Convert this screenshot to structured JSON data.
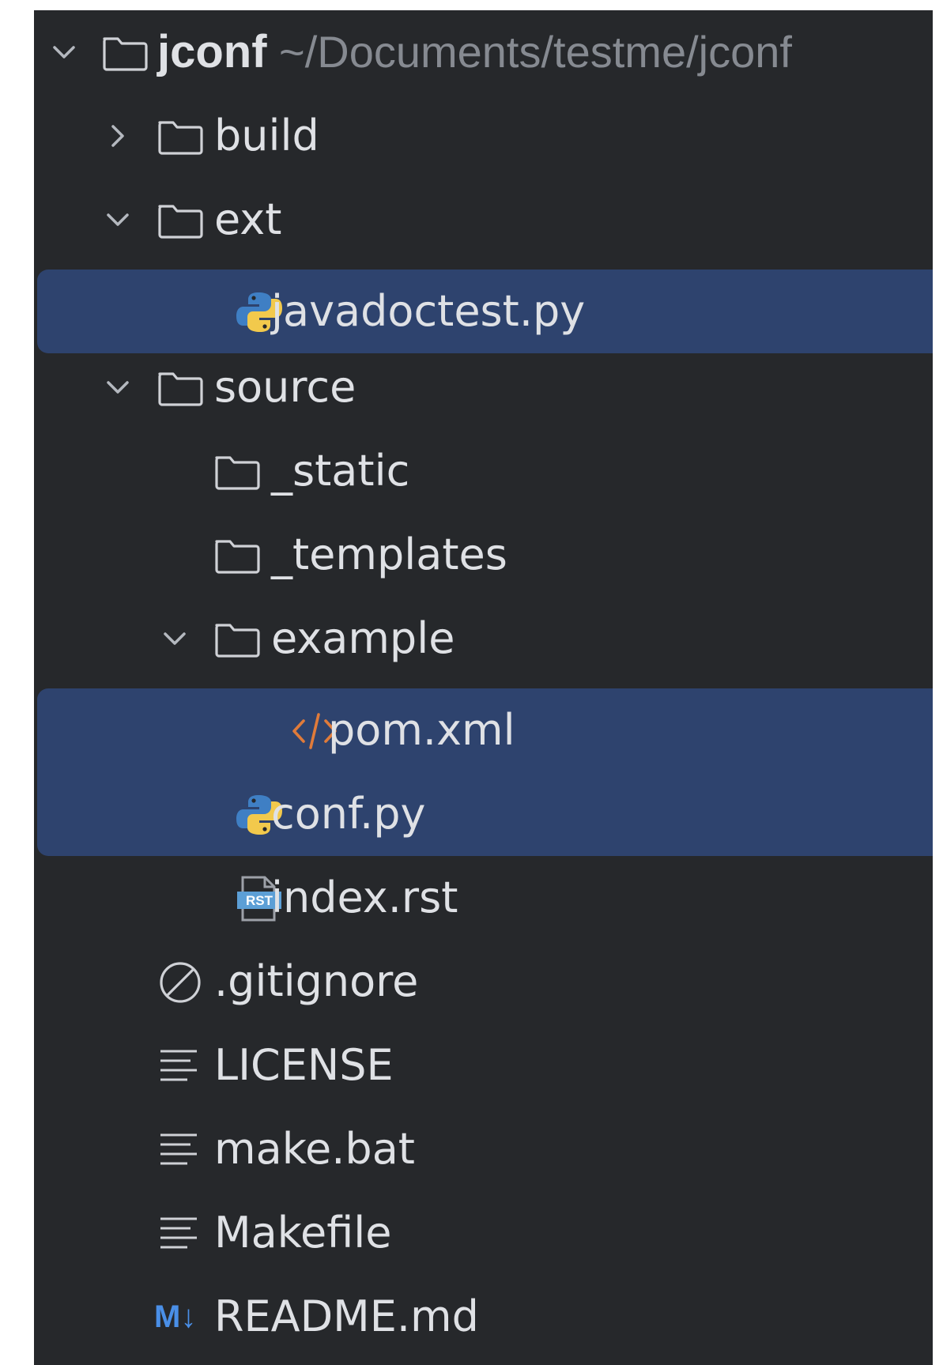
{
  "tree": {
    "root": {
      "name": "jconf",
      "path": "~/Documents/testme/jconf"
    },
    "items": [
      {
        "label": "build"
      },
      {
        "label": "ext"
      },
      {
        "label": "javadoctest.py"
      },
      {
        "label": "source"
      },
      {
        "label": "_static"
      },
      {
        "label": "_templates"
      },
      {
        "label": "example"
      },
      {
        "label": "pom.xml"
      },
      {
        "label": "conf.py"
      },
      {
        "label": "index.rst"
      },
      {
        "label": ".gitignore"
      },
      {
        "label": "LICENSE"
      },
      {
        "label": "make.bat"
      },
      {
        "label": "Makefile"
      },
      {
        "label": "README.md"
      }
    ]
  },
  "icons": {
    "markdown_glyph": "M↓",
    "rst_glyph": "RST"
  },
  "colors": {
    "panel_bg": "#26282b",
    "selection": "#2e436e",
    "text": "#dfe1e5",
    "path_text": "#868a91",
    "markdown_accent": "#4a8fe7",
    "xml_accent": "#e07b3a"
  }
}
